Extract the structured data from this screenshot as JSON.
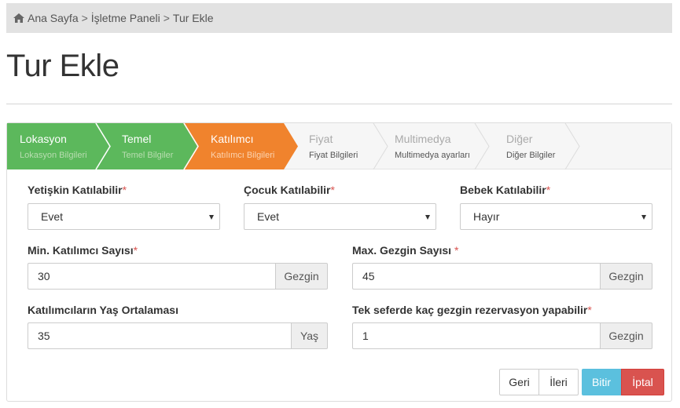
{
  "breadcrumb": {
    "icon": "home-icon",
    "items": [
      "Ana Sayfa",
      "İşletme Paneli",
      "Tur Ekle"
    ],
    "separator": ">"
  },
  "page": {
    "title": "Tur Ekle"
  },
  "colors": {
    "done": "#5cb85c",
    "active": "#f0832d",
    "todo": "#f6f6f6",
    "required": "#d9534f",
    "info": "#5bc0de",
    "danger": "#d9534f"
  },
  "wizard": {
    "steps": [
      {
        "title": "Lokasyon",
        "subtitle": "Lokasyon Bilgileri",
        "status": "done"
      },
      {
        "title": "Temel",
        "subtitle": "Temel Bilgiler",
        "status": "done"
      },
      {
        "title": "Katılımcı",
        "subtitle": "Katılımcı Bilgileri",
        "status": "active"
      },
      {
        "title": "Fiyat",
        "subtitle": "Fiyat Bilgileri",
        "status": "todo"
      },
      {
        "title": "Multimedya",
        "subtitle": "Multimedya ayarları",
        "status": "todo"
      },
      {
        "title": "Diğer",
        "subtitle": "Diğer Bilgiler",
        "status": "todo"
      }
    ]
  },
  "form": {
    "required_mark": "*",
    "adult": {
      "label": "Yetişkin Katılabilir",
      "value": "Evet"
    },
    "child": {
      "label": "Çocuk Katılabilir",
      "value": "Evet"
    },
    "baby": {
      "label": "Bebek Katılabilir",
      "value": "Hayır"
    },
    "min_participants": {
      "label": "Min. Katılımcı Sayısı",
      "value": "30",
      "addon": "Gezgin"
    },
    "max_travelers": {
      "label": "Max. Gezgin Sayısı",
      "value": "45",
      "addon": "Gezgin"
    },
    "age_average": {
      "label": "Katılımcıların Yaş Ortalaması",
      "value": "35",
      "addon": "Yaş"
    },
    "per_booking": {
      "label": "Tek seferde kaç gezgin rezervasyon yapabilir",
      "value": "1",
      "addon": "Gezgin"
    }
  },
  "buttons": {
    "back": "Geri",
    "next": "İleri",
    "finish": "Bitir",
    "cancel": "İptal"
  }
}
